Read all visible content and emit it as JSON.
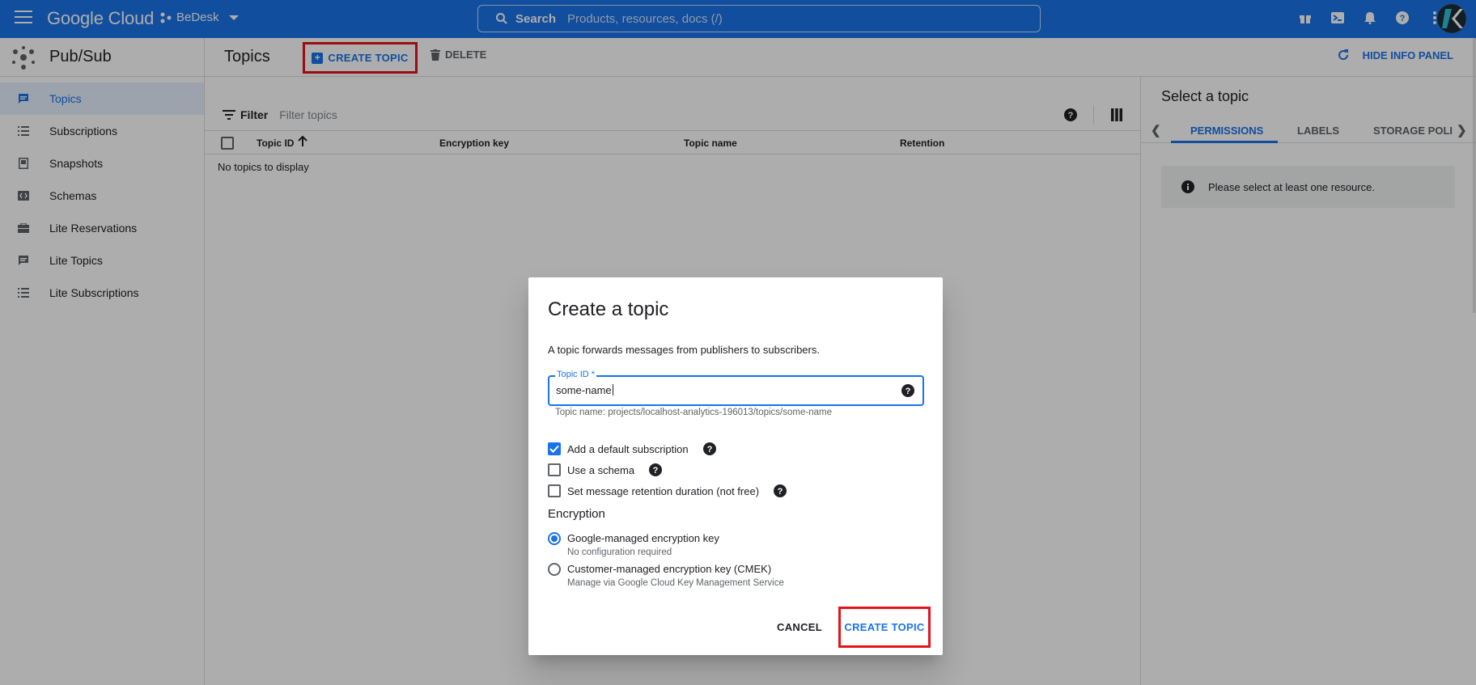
{
  "topbar": {
    "logo": "Google Cloud",
    "project": "BeDesk",
    "search_label": "Search",
    "search_placeholder": "Products, resources, docs (/)"
  },
  "sidebar": {
    "title": "Pub/Sub",
    "items": [
      {
        "label": "Topics",
        "active": true
      },
      {
        "label": "Subscriptions"
      },
      {
        "label": "Snapshots"
      },
      {
        "label": "Schemas"
      },
      {
        "label": "Lite Reservations"
      },
      {
        "label": "Lite Topics"
      },
      {
        "label": "Lite Subscriptions"
      }
    ]
  },
  "header": {
    "title": "Topics",
    "create_label": "CREATE TOPIC",
    "delete_label": "DELETE",
    "hide_info_label": "HIDE INFO PANEL"
  },
  "table": {
    "filter_label": "Filter",
    "filter_placeholder": "Filter topics",
    "columns": [
      "Topic ID",
      "Encryption key",
      "Topic name",
      "Retention"
    ],
    "empty_text": "No topics to display"
  },
  "info_panel": {
    "title": "Select a topic",
    "tabs": [
      "PERMISSIONS",
      "LABELS",
      "STORAGE POLI"
    ],
    "message": "Please select at least one resource."
  },
  "dialog": {
    "title": "Create a topic",
    "description": "A topic forwards messages from publishers to subscribers.",
    "field_label": "Topic ID *",
    "field_value": "some-name",
    "hint": "Topic name: projects/localhost-analytics-196013/topics/some-name",
    "options": [
      {
        "label": "Add a default subscription",
        "checked": true
      },
      {
        "label": "Use a schema",
        "checked": false
      },
      {
        "label": "Set message retention duration (not free)",
        "checked": false
      }
    ],
    "encryption_title": "Encryption",
    "radios": [
      {
        "label": "Google-managed encryption key",
        "sub": "No configuration required",
        "selected": true
      },
      {
        "label": "Customer-managed encryption key (CMEK)",
        "sub": "Manage via Google Cloud Key Management Service",
        "selected": false
      }
    ],
    "cancel_label": "CANCEL",
    "create_label": "CREATE TOPIC"
  },
  "colors": {
    "brand": "#1a73e8",
    "highlight": "#e3141a"
  }
}
